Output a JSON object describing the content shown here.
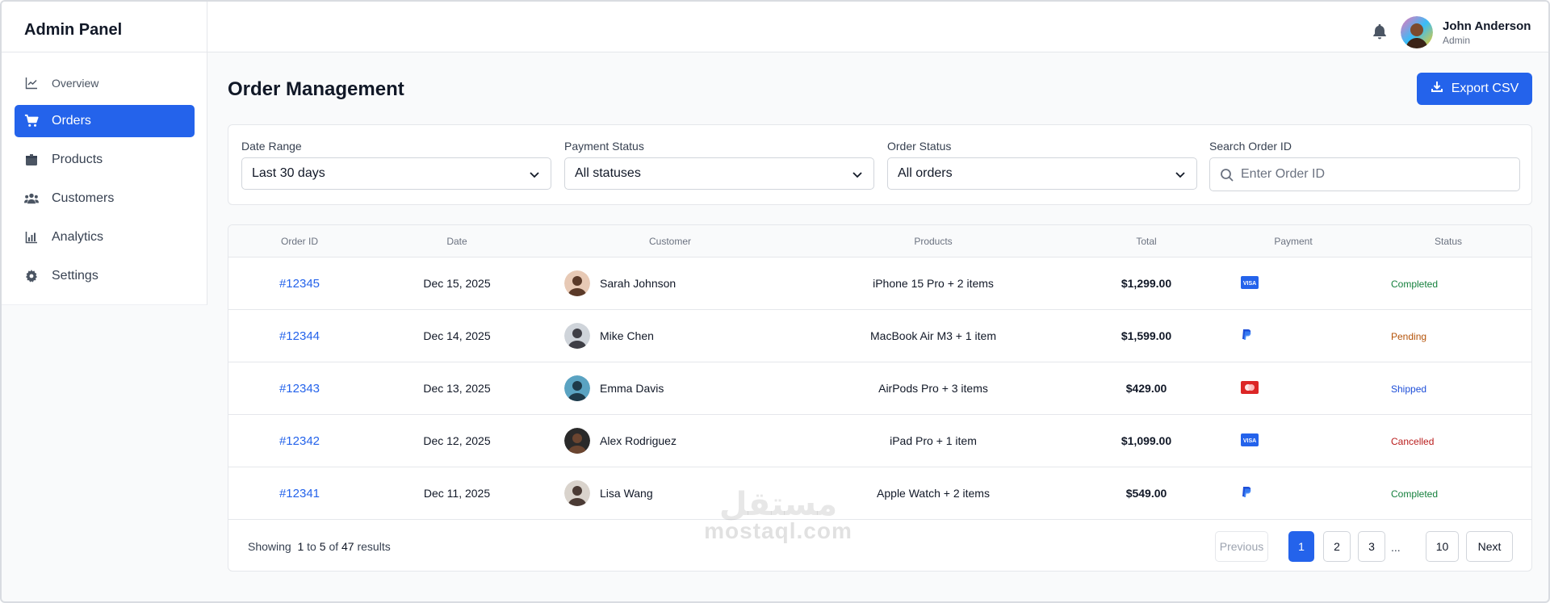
{
  "header": {
    "brand": "Admin Panel",
    "user": {
      "name": "John Anderson",
      "role": "Admin"
    }
  },
  "sidebar": {
    "items": [
      {
        "label": "Overview",
        "icon": "chart-line-icon",
        "active": false
      },
      {
        "label": "Orders",
        "icon": "cart-icon",
        "active": true
      },
      {
        "label": "Products",
        "icon": "box-icon",
        "active": false
      },
      {
        "label": "Customers",
        "icon": "users-icon",
        "active": false
      },
      {
        "label": "Analytics",
        "icon": "bar-chart-icon",
        "active": false
      },
      {
        "label": "Settings",
        "icon": "gear-icon",
        "active": false
      }
    ]
  },
  "main": {
    "title": "Order Management",
    "export_label": "Export CSV"
  },
  "filters": {
    "date_range": {
      "label": "Date Range",
      "value": "Last 30 days"
    },
    "payment_status": {
      "label": "Payment Status",
      "value": "All statuses"
    },
    "order_status": {
      "label": "Order Status",
      "value": "All orders"
    },
    "search": {
      "label": "Search Order ID",
      "placeholder": "Enter Order ID"
    }
  },
  "table": {
    "columns": [
      "Order ID",
      "Date",
      "Customer",
      "Products",
      "Total",
      "Payment",
      "Status"
    ],
    "rows": [
      {
        "id": "#12345",
        "date": "Dec 15, 2025",
        "customer": "Sarah Johnson",
        "products": "iPhone 15 Pro + 2 items",
        "total": "$1,299.00",
        "payment": "visa-icon",
        "status": "Completed"
      },
      {
        "id": "#12344",
        "date": "Dec 14, 2025",
        "customer": "Mike Chen",
        "products": "MacBook Air M3 + 1 item",
        "total": "$1,599.00",
        "payment": "paypal-icon",
        "status": "Pending"
      },
      {
        "id": "#12343",
        "date": "Dec 13, 2025",
        "customer": "Emma Davis",
        "products": "AirPods Pro + 3 items",
        "total": "$429.00",
        "payment": "mastercard-icon",
        "status": "Shipped"
      },
      {
        "id": "#12342",
        "date": "Dec 12, 2025",
        "customer": "Alex Rodriguez",
        "products": "iPad Pro + 1 item",
        "total": "$1,099.00",
        "payment": "visa-icon",
        "status": "Cancelled"
      },
      {
        "id": "#12341",
        "date": "Dec 11, 2025",
        "customer": "Lisa Wang",
        "products": "Apple Watch + 2 items",
        "total": "$549.00",
        "payment": "paypal-icon",
        "status": "Completed"
      }
    ]
  },
  "status_colors": {
    "Completed": "#15803d",
    "Pending": "#b45309",
    "Shipped": "#1d4ed8",
    "Cancelled": "#b91c1c"
  },
  "pagination": {
    "showing_prefix": "Showing",
    "from": "1",
    "to_word": "to",
    "to": "5",
    "of_word": "of",
    "total": "47",
    "suffix": "results",
    "previous": "Previous",
    "pages": [
      "1",
      "2",
      "3"
    ],
    "ellipsis": "...",
    "last": "10",
    "next": "Next",
    "current": "1"
  },
  "watermark": {
    "arabic": "مستقل",
    "latin": "mostaql.com"
  },
  "colors": {
    "accent": "#2463eb"
  }
}
